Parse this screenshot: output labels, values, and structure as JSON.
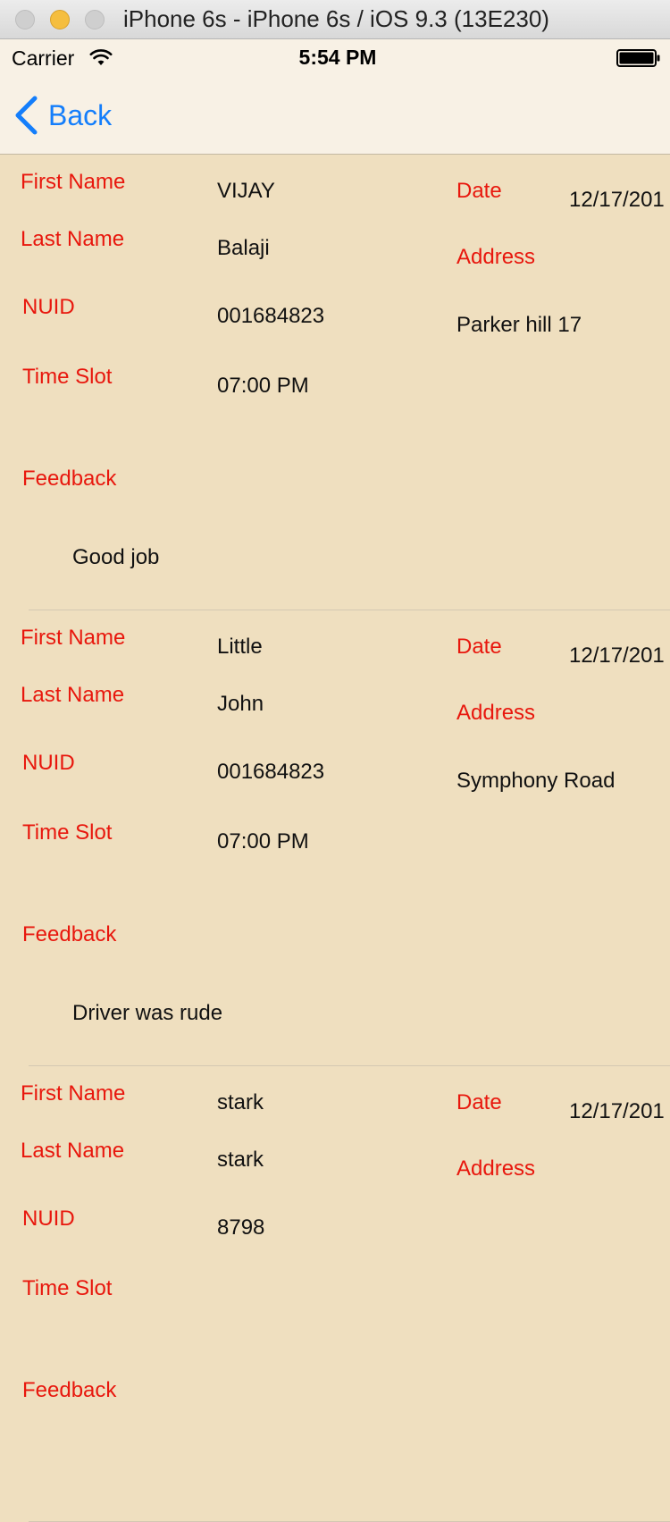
{
  "window": {
    "title": "iPhone 6s - iPhone 6s / iOS 9.3 (13E230)"
  },
  "status_bar": {
    "carrier": "Carrier",
    "time": "5:54 PM"
  },
  "nav": {
    "back_label": "Back"
  },
  "labels": {
    "first_name": "First Name",
    "last_name": "Last Name",
    "nuid": "NUID",
    "time_slot": "Time Slot",
    "feedback": "Feedback",
    "date": "Date",
    "address": "Address"
  },
  "entries": [
    {
      "first_name": "VIJAY",
      "last_name": "Balaji",
      "nuid": "001684823",
      "time_slot": "07:00 PM",
      "date": "12/17/201",
      "address": "Parker hill 17",
      "feedback": "Good job"
    },
    {
      "first_name": "Little",
      "last_name": "John",
      "nuid": "001684823",
      "time_slot": "07:00 PM",
      "date": "12/17/201",
      "address": "Symphony Road",
      "feedback": "Driver was rude"
    },
    {
      "first_name": "stark",
      "last_name": "stark",
      "nuid": "8798",
      "time_slot": "",
      "date": "12/17/201",
      "address": "",
      "feedback": ""
    }
  ],
  "colors": {
    "background": "#efdfbf",
    "nav_background": "#f8f1e5",
    "label_red": "#e8170d",
    "ios_blue": "#147efb",
    "minimize_yellow": "#f5be3f"
  },
  "icons": {
    "wifi": "wifi-icon",
    "battery": "battery-icon",
    "back": "chevron-left-icon"
  }
}
